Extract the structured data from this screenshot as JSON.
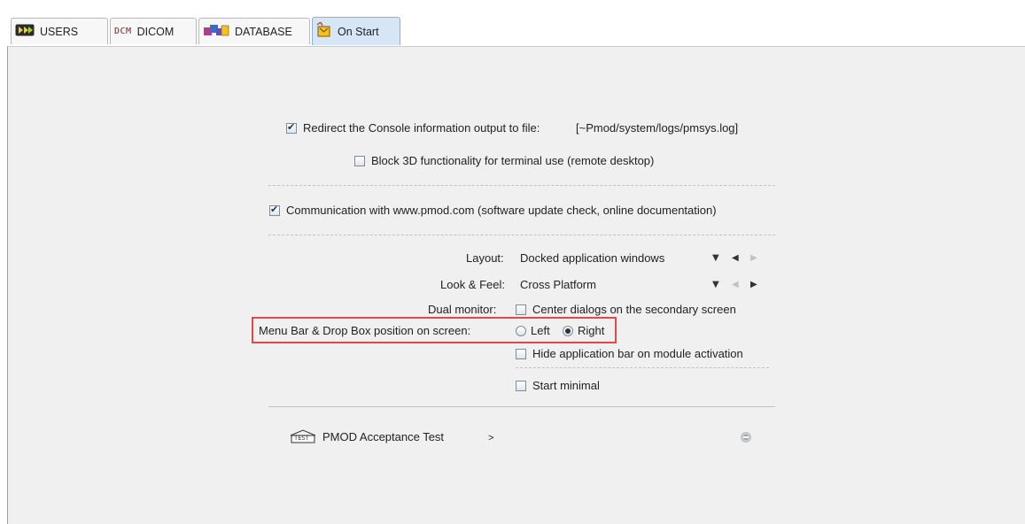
{
  "tabs": [
    {
      "label": "USERS",
      "icon": "users-icon",
      "active": false
    },
    {
      "label": "DICOM",
      "icon_text": "DCM",
      "active": false
    },
    {
      "label": "DATABASE",
      "icon": "database-icon",
      "active": false
    },
    {
      "label": "On Start",
      "icon": "on-start-icon",
      "active": true
    }
  ],
  "options": {
    "redirect_console_label": "Redirect the Console information output to file:",
    "redirect_console_path": "[~Pmod/system/logs/pmsys.log]",
    "redirect_console_checked": true,
    "block_3d_label": "Block 3D functionality for terminal use (remote desktop)",
    "block_3d_checked": false,
    "communication_label": "Communication with www.pmod.com (software update check, online documentation)",
    "communication_checked": true
  },
  "layout": {
    "label": "Layout:",
    "value": "Docked application windows"
  },
  "look_feel": {
    "label": "Look & Feel:",
    "value": "Cross Platform"
  },
  "dual_monitor": {
    "label": "Dual monitor:",
    "option_label": "Center dialogs on the secondary screen",
    "checked": false
  },
  "menu_bar": {
    "label": "Menu Bar & Drop Box position on screen:",
    "left_label": "Left",
    "right_label": "Right",
    "selected": "Right"
  },
  "hide_app_bar": {
    "label": "Hide application bar on module activation",
    "checked": false
  },
  "start_minimal": {
    "label": "Start minimal",
    "checked": false
  },
  "acceptance": {
    "icon_text": "TEST",
    "label": "PMOD Acceptance Test",
    "chevron": ">"
  },
  "colors": {
    "highlight": "#e2484a",
    "active_tab": "#d6e6f5",
    "panel": "#f0f0f0"
  }
}
